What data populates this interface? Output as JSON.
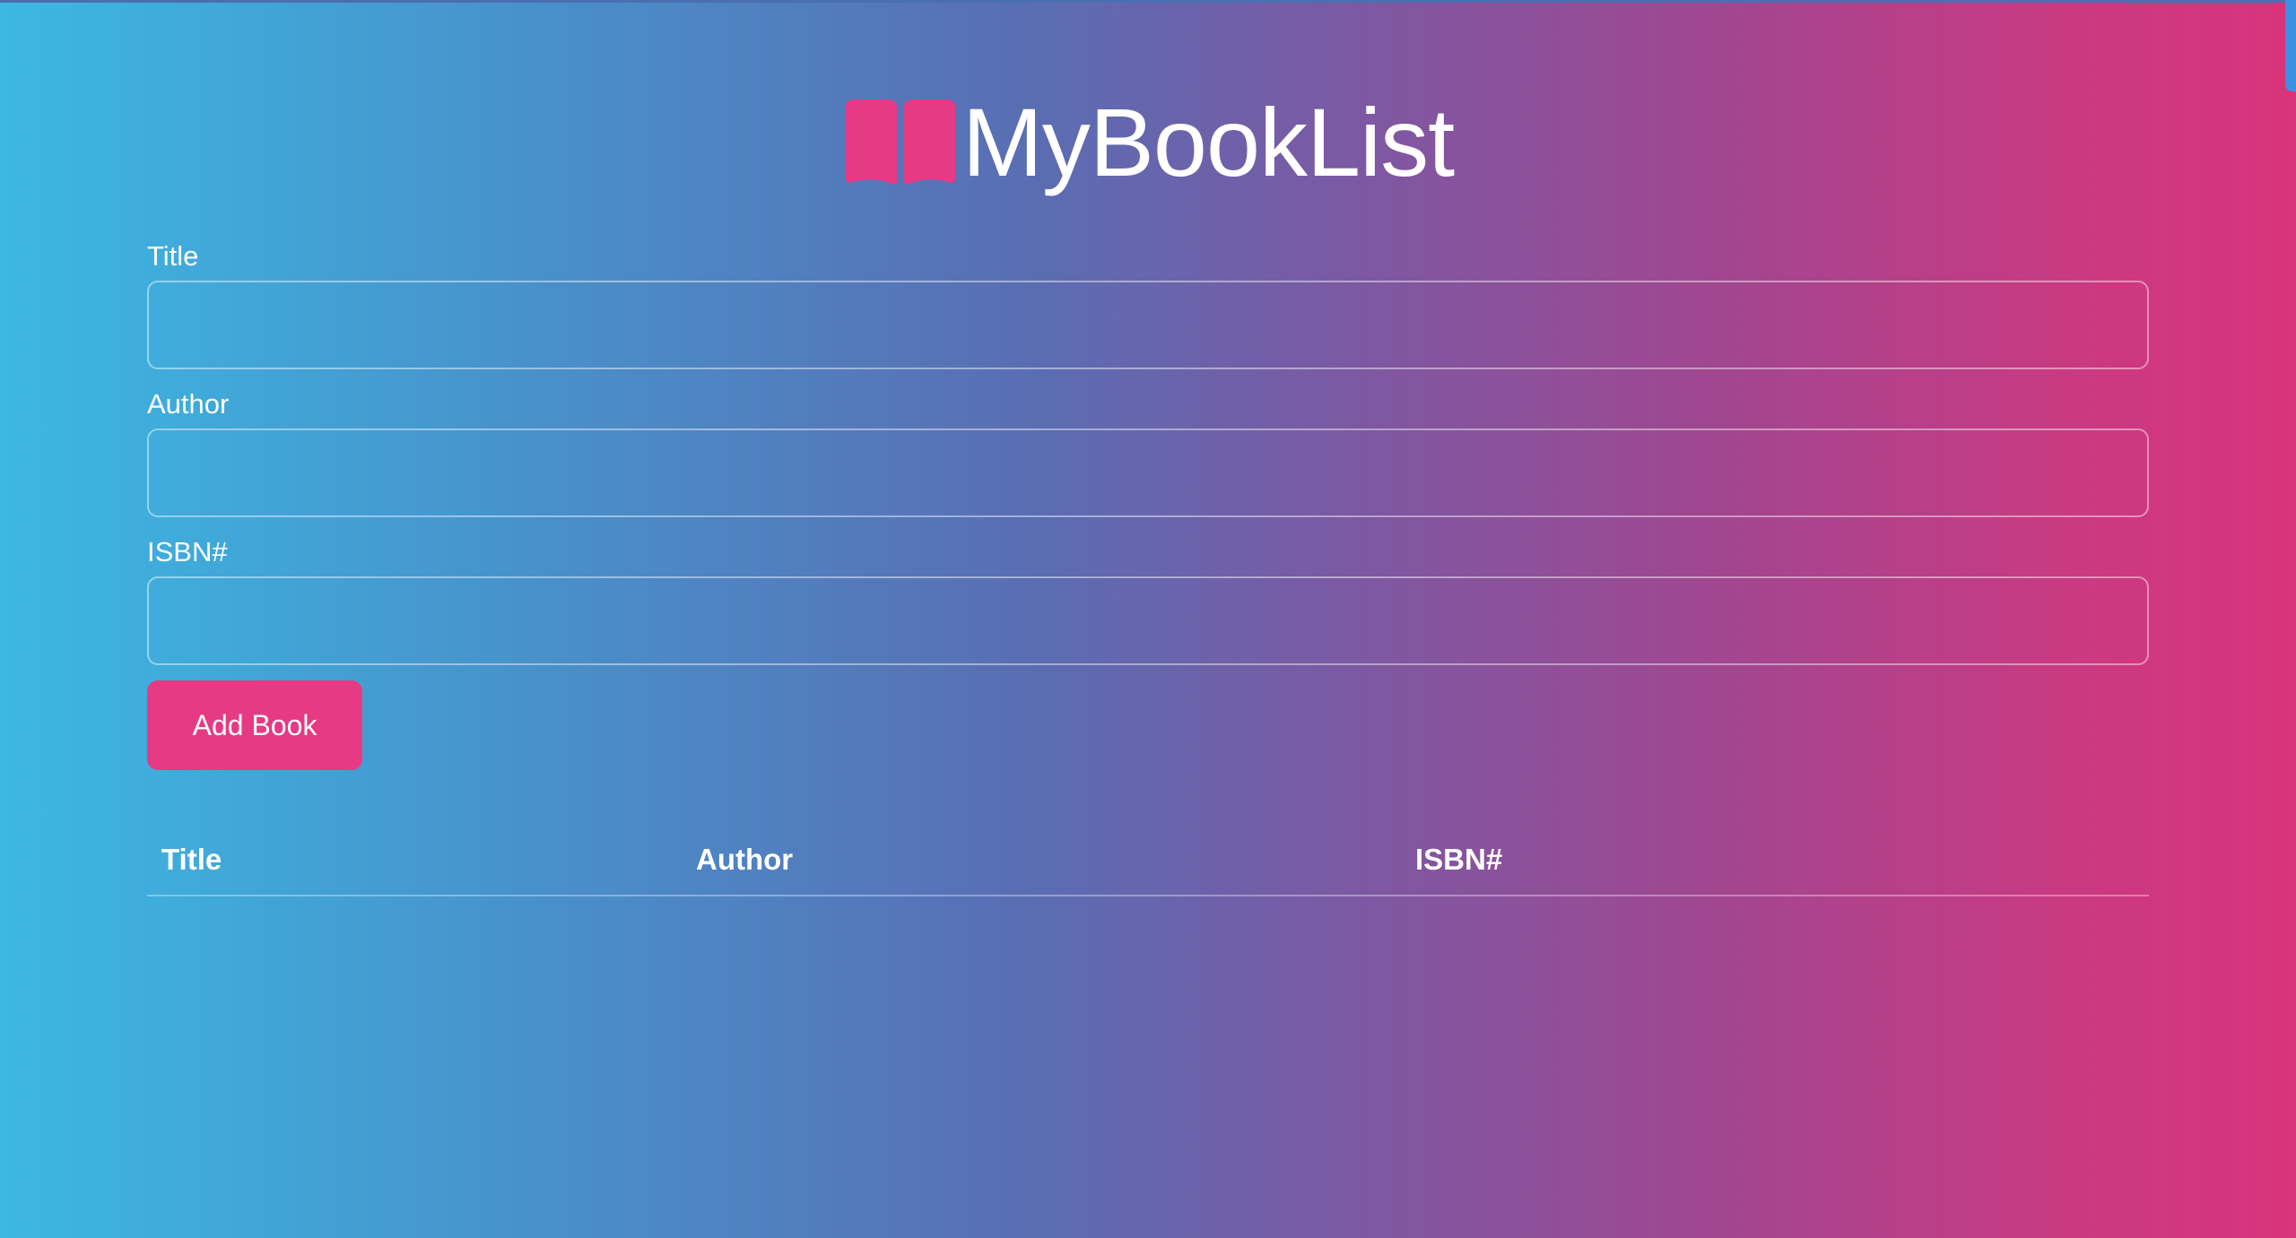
{
  "header": {
    "logo_icon": "open-book-icon",
    "title": "MyBookList",
    "accent_color": "#e63a85"
  },
  "form": {
    "title_label": "Title",
    "title_value": "",
    "author_label": "Author",
    "author_value": "",
    "isbn_label": "ISBN#",
    "isbn_value": "",
    "submit_label": "Add Book"
  },
  "table": {
    "columns": [
      "Title",
      "Author",
      "ISBN#"
    ],
    "rows": []
  }
}
